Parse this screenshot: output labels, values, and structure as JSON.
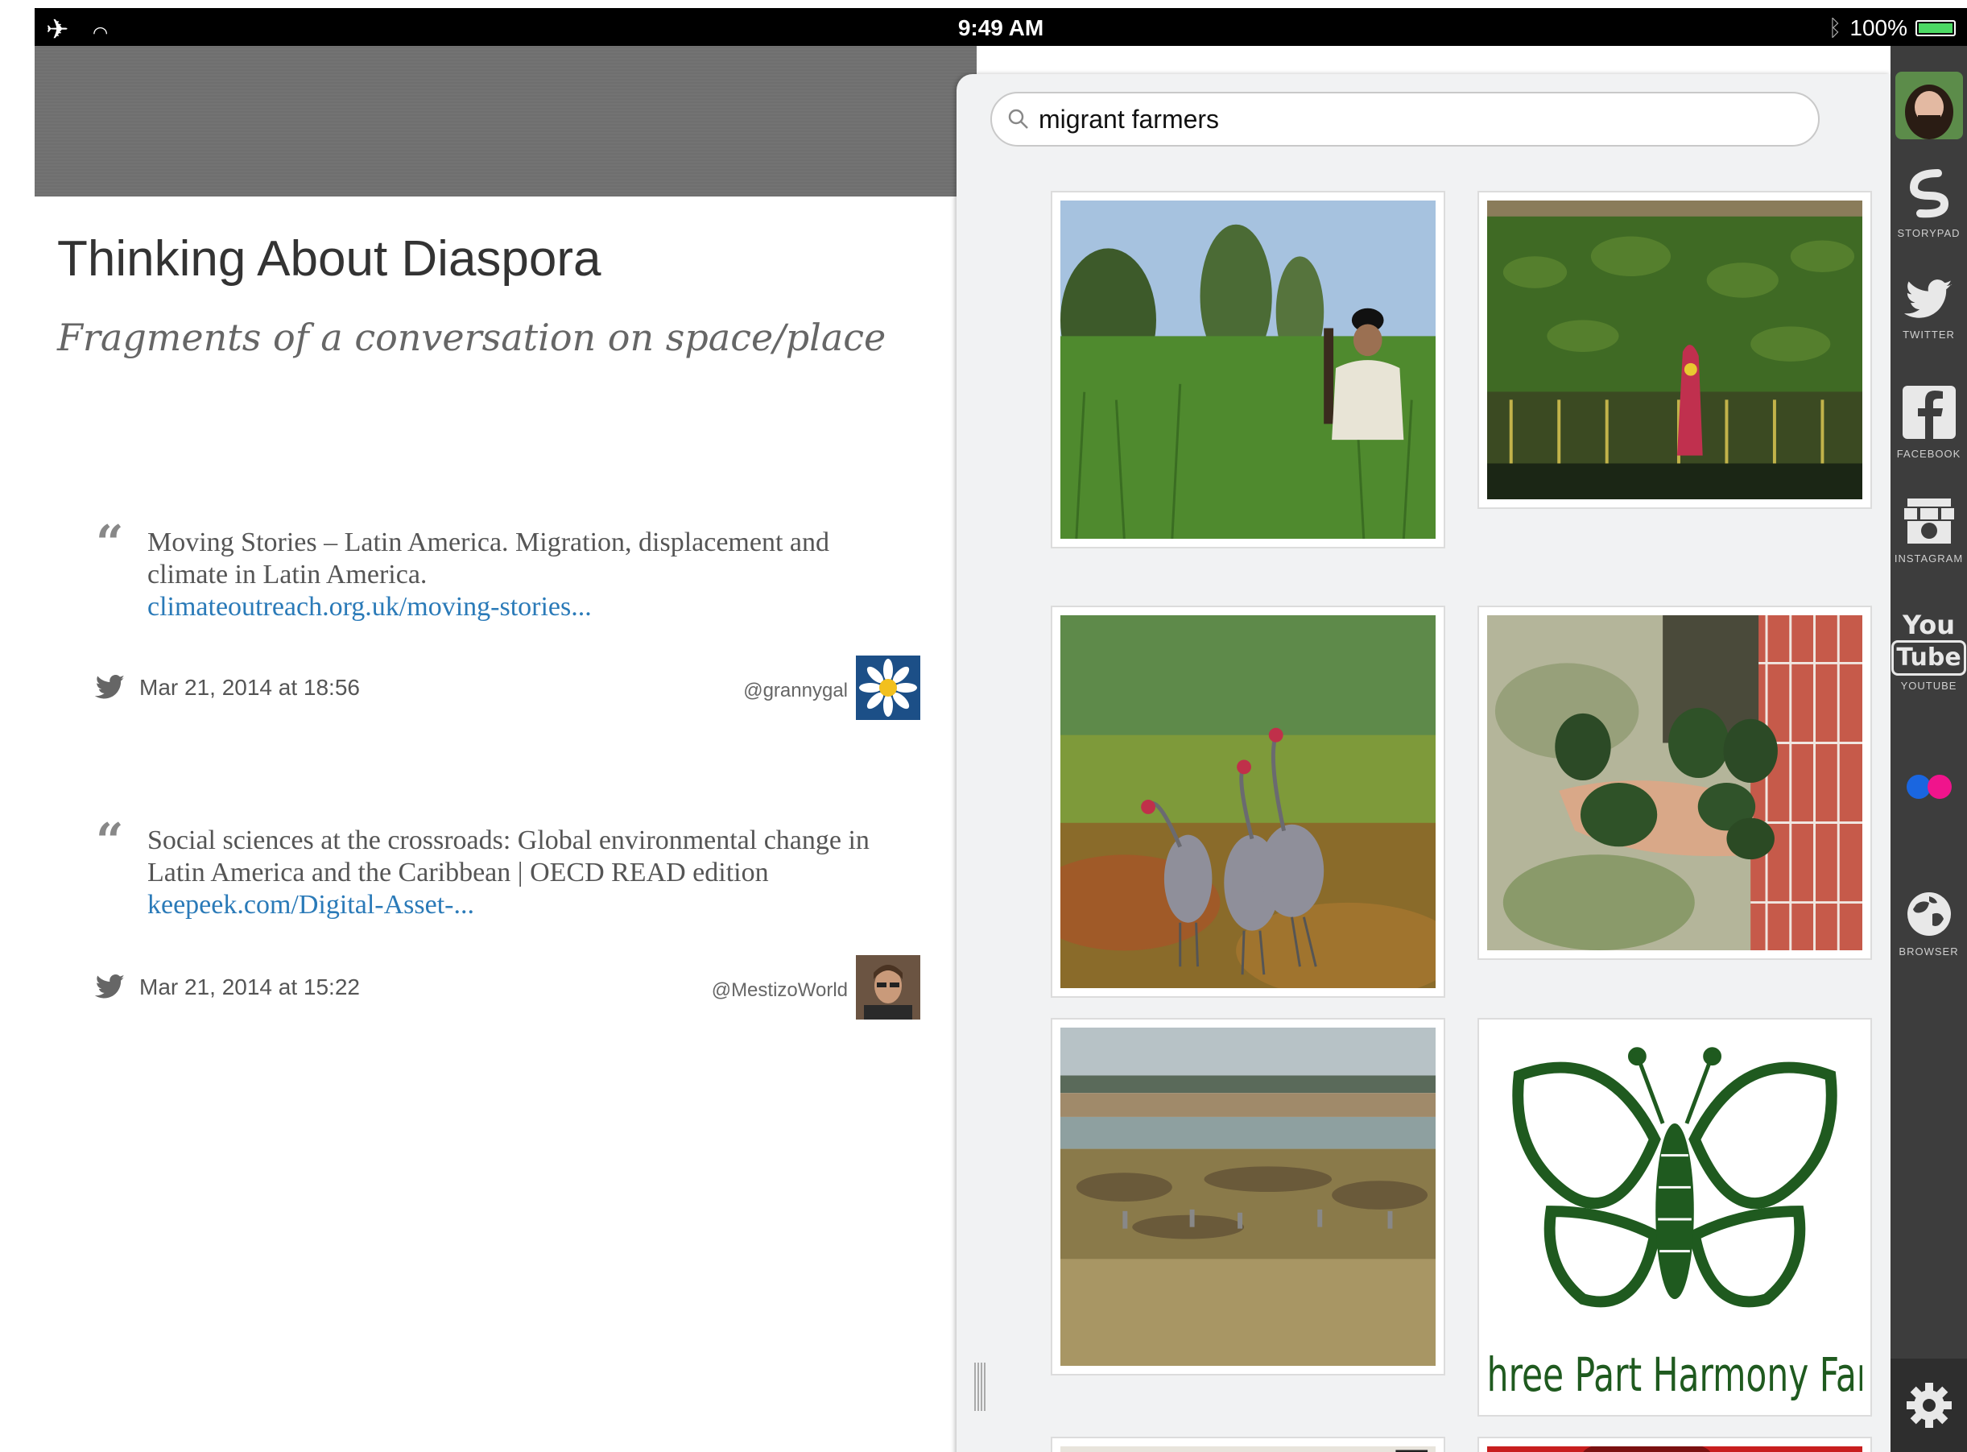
{
  "status_bar": {
    "time": "9:49 AM",
    "battery": "100%",
    "left_icons": [
      "airplane-icon",
      "wifi-icon"
    ],
    "right_icons": [
      "bluetooth-icon",
      "battery-icon"
    ]
  },
  "story": {
    "title": "Thinking About Diaspora",
    "subtitle": "Fragments of a conversation on space/place",
    "tweets": [
      {
        "text": "Moving Stories – Latin America. Migration, displacement and climate in Latin America.",
        "link": "climateoutreach.org.uk/moving-stories...",
        "date": "Mar 21, 2014 at 18:56",
        "handle": "@grannygal"
      },
      {
        "text": "Social sciences at the crossroads: Global environmental change in Latin America and the Caribbean | OECD READ edition",
        "link": "keepeek.com/Digital-Asset-...",
        "date": "Mar 21, 2014 at 15:22",
        "handle": "@MestizoWorld"
      }
    ]
  },
  "search": {
    "value": "migrant farmers",
    "placeholder": ""
  },
  "results": {
    "tile_6_text": "Three Part Harmony Farr"
  },
  "sidebar": {
    "items": [
      {
        "label": "STORYPAD",
        "icon": "storypad-icon"
      },
      {
        "label": "TWITTER",
        "icon": "twitter-icon"
      },
      {
        "label": "FACEBOOK",
        "icon": "facebook-icon"
      },
      {
        "label": "INSTAGRAM",
        "icon": "instagram-icon"
      },
      {
        "label": "YOUTUBE",
        "icon": "youtube-icon",
        "logo_top": "You",
        "logo_bottom": "Tube"
      },
      {
        "label": "",
        "icon": "flickr-icon"
      },
      {
        "label": "BROWSER",
        "icon": "globe-icon"
      }
    ]
  },
  "colors": {
    "link": "#2a7ab8",
    "sidebar_bg": "#3d3d3d",
    "farm_logo_green": "#1f5a1f"
  }
}
